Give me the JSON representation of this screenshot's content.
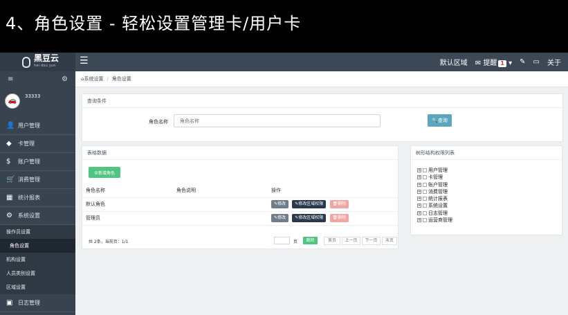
{
  "slide": {
    "title": "4、角色设置 - 轻松设置管理卡/用户卡"
  },
  "header": {
    "logo_text": "黑豆云",
    "logo_subtext": "hei dou yun",
    "menu_icon": "☰",
    "region": "默认区域",
    "reminder": "提醒",
    "reminder_count": "1",
    "dropdown": "▾",
    "edit_icon": "✎",
    "screen_icon": "▭",
    "about": "关于"
  },
  "sidebar": {
    "toggle_icon": "≡",
    "settings_icon": "⚙",
    "user": "33333",
    "user_avatar": "🚗",
    "items": [
      {
        "label": "用户管理",
        "icon": "👤"
      },
      {
        "label": "卡管理",
        "icon": "◆"
      },
      {
        "label": "账户管理",
        "icon": "$"
      },
      {
        "label": "消费管理",
        "icon": "🛒"
      },
      {
        "label": "统计报表",
        "icon": "▦"
      },
      {
        "label": "系统设置",
        "icon": "⚙"
      }
    ],
    "subitems": [
      {
        "label": "操作员设置",
        "active": false
      },
      {
        "label": "角色设置",
        "active": true
      },
      {
        "label": "机构设置",
        "active": false
      },
      {
        "label": "人员类别设置",
        "active": false
      },
      {
        "label": "区域设置",
        "active": false
      }
    ],
    "last_item": {
      "label": "日志管理",
      "icon": "▣"
    }
  },
  "breadcrumb": {
    "home_icon": "⌂",
    "first": "系统设置",
    "separator": "/",
    "current": "角色设置"
  },
  "query": {
    "title": "查询条件",
    "label": "角色名称",
    "placeholder": "角色名称",
    "button": "🔍查询"
  },
  "table": {
    "title": "表格数据",
    "add_button": "⊕新增角色",
    "columns": [
      "角色名称",
      "角色说明",
      "操作"
    ],
    "rows": [
      {
        "name": "默认角色",
        "desc": ""
      },
      {
        "name": "管理员",
        "desc": ""
      }
    ],
    "actions": {
      "edit": "✎修改",
      "region": "✎修改区域权限",
      "delete": "🗑删除"
    },
    "pager_info": "共 2条，当前页：1/1",
    "page_unit": "页",
    "jump": "跳转",
    "pages": [
      "首页",
      "上一页",
      "下一页",
      "末页"
    ]
  },
  "tree": {
    "title": "树形结构权限列表",
    "nodes": [
      "用户管理",
      "卡管理",
      "账户管理",
      "消费管理",
      "统计报表",
      "系统设置",
      "日志管理",
      "运营商管理"
    ],
    "expand_symbol": "+"
  }
}
